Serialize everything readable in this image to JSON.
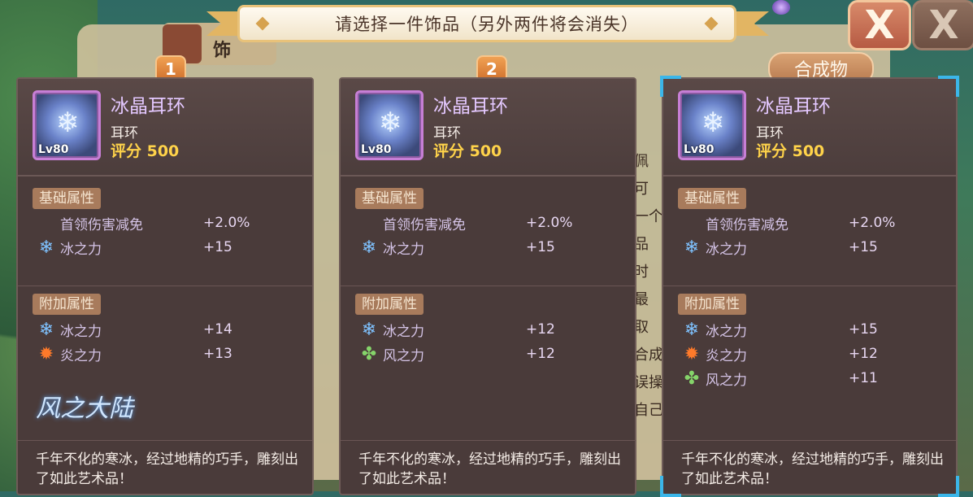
{
  "banner": {
    "text": "请选择一件饰品（另外两件将会消失）"
  },
  "background": {
    "tab_text": "饰",
    "side_text": "佩 可 一个 品 时 最 取 合成 误操 自己"
  },
  "close_glyph": "X",
  "cards": [
    {
      "badge": "1",
      "name": "冰晶耳环",
      "type": "耳环",
      "score": "评分 500",
      "level": "Lv80",
      "base_label": "基础属性",
      "base_attrs": [
        {
          "icon": "none",
          "name": "首领伤害减免",
          "value": "+2.0%"
        },
        {
          "icon": "ice-icon",
          "name": "冰之力",
          "value": "+15"
        }
      ],
      "extra_label": "附加属性",
      "extra_attrs": [
        {
          "icon": "ice-icon",
          "name": "冰之力",
          "value": "+14"
        },
        {
          "icon": "fire-icon",
          "name": "炎之力",
          "value": "+13"
        }
      ],
      "logo_text": "风之大陆",
      "description": "千年不化的寒冰，经过地精的巧手，雕刻出了如此艺术品！"
    },
    {
      "badge": "2",
      "name": "冰晶耳环",
      "type": "耳环",
      "score": "评分 500",
      "level": "Lv80",
      "base_label": "基础属性",
      "base_attrs": [
        {
          "icon": "none",
          "name": "首领伤害减免",
          "value": "+2.0%"
        },
        {
          "icon": "ice-icon",
          "name": "冰之力",
          "value": "+15"
        }
      ],
      "extra_label": "附加属性",
      "extra_attrs": [
        {
          "icon": "ice-icon",
          "name": "冰之力",
          "value": "+12"
        },
        {
          "icon": "wind-icon",
          "name": "风之力",
          "value": "+12"
        }
      ],
      "description": "千年不化的寒冰，经过地精的巧手，雕刻出了如此艺术品！"
    },
    {
      "badge": "合成物",
      "name": "冰晶耳环",
      "type": "耳环",
      "score": "评分 500",
      "level": "Lv80",
      "base_label": "基础属性",
      "base_attrs": [
        {
          "icon": "none",
          "name": "首领伤害减免",
          "value": "+2.0%"
        },
        {
          "icon": "ice-icon",
          "name": "冰之力",
          "value": "+15"
        }
      ],
      "extra_label": "附加属性",
      "extra_attrs": [
        {
          "icon": "ice-icon",
          "name": "冰之力",
          "value": "+15"
        },
        {
          "icon": "fire-icon",
          "name": "炎之力",
          "value": "+12"
        },
        {
          "icon": "wind-icon",
          "name": "风之力",
          "value": "+11"
        }
      ],
      "description": "千年不化的寒冰，经过地精的巧手，雕刻出了如此艺术品！"
    }
  ]
}
